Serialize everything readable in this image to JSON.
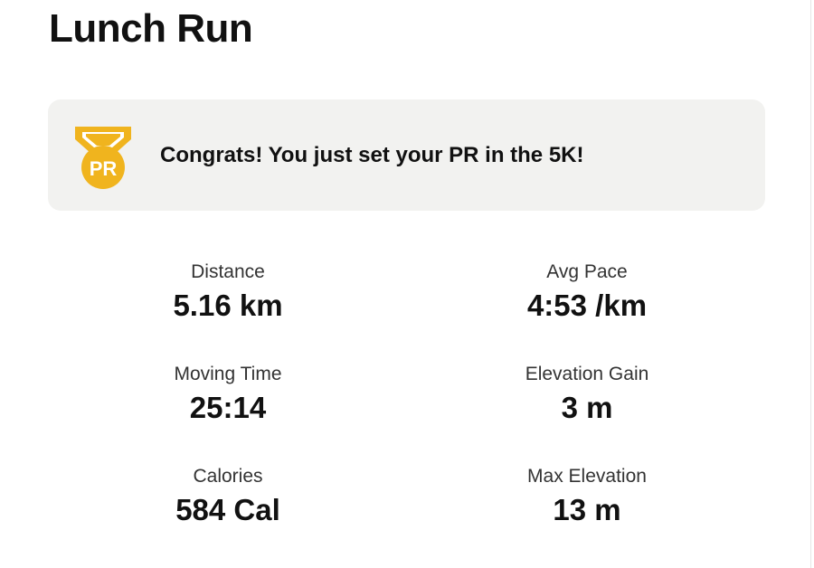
{
  "activity": {
    "title": "Lunch Run"
  },
  "banner": {
    "medal_text": "PR",
    "medal_icon": "pr-medal-icon",
    "message": "Congrats! You just set your PR in the 5K!",
    "medal_color": "#F0B41E",
    "background_color": "#F2F2F0"
  },
  "stats": [
    {
      "label": "Distance",
      "value": "5.16 km"
    },
    {
      "label": "Avg Pace",
      "value": "4:53 /km"
    },
    {
      "label": "Moving Time",
      "value": "25:14"
    },
    {
      "label": "Elevation Gain",
      "value": "3 m"
    },
    {
      "label": "Calories",
      "value": "584 Cal"
    },
    {
      "label": "Max Elevation",
      "value": "13 m"
    }
  ]
}
